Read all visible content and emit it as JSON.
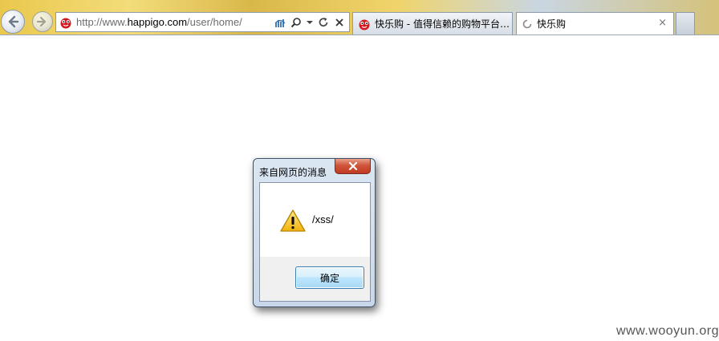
{
  "browser": {
    "address_bar": {
      "url_prefix": "http://www.",
      "url_domain": "happigo.com",
      "url_path": "/user/home/"
    },
    "tabs": [
      {
        "label": "快乐购 - 值得信赖的购物平台,...",
        "state": "inactive",
        "icon": "happigo-logo-icon"
      },
      {
        "label": "快乐购",
        "state": "active-loading",
        "icon": "loading-spinner-icon",
        "close": "×"
      }
    ],
    "toolbar_icons": [
      "compatibility-view-icon",
      "search-icon",
      "dropdown-icon",
      "refresh-icon",
      "stop-icon"
    ]
  },
  "dialog": {
    "title": "来自网页的消息",
    "message": "/xss/",
    "ok_label": "确定",
    "icon": "warning-icon"
  },
  "watermark": "www.wooyun.org"
}
